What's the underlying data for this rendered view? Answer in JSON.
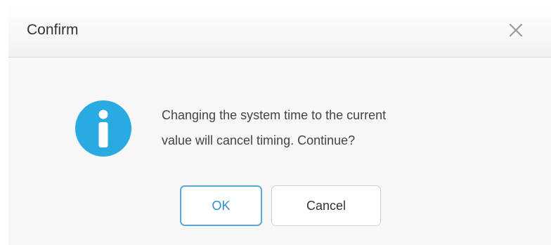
{
  "dialog": {
    "title": "Confirm",
    "close_icon": "close-icon",
    "info_icon": "info-icon",
    "message_line1": "Changing the system time to the current",
    "message_line2": "value will cancel timing. Continue?",
    "ok_label": "OK",
    "cancel_label": "Cancel"
  },
  "colors": {
    "accent": "#29aae1",
    "ok_border": "#5aa8d8",
    "ok_text": "#2a8fd0",
    "dialog_bg": "#f7f7f7"
  }
}
